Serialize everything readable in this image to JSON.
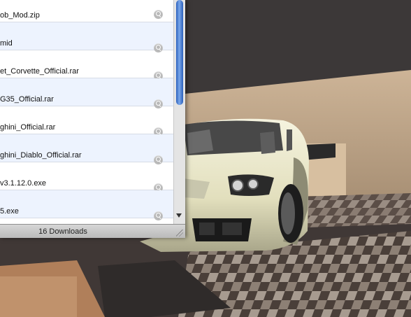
{
  "downloads": {
    "items": [
      {
        "name": "ob_Mod.zip",
        "icon": "magnifier-icon"
      },
      {
        "name": "mid",
        "icon": "magnifier-icon"
      },
      {
        "name": "et_Corvette_Official.rar",
        "icon": "magnifier-icon"
      },
      {
        "name": "G35_Official.rar",
        "icon": "magnifier-icon"
      },
      {
        "name": "ghini_Official.rar",
        "icon": "magnifier-icon"
      },
      {
        "name": "ghini_Diablo_Official.rar",
        "icon": "magnifier-icon"
      },
      {
        "name": "v3.1.12.0.exe",
        "icon": "magnifier-icon"
      },
      {
        "name": "5.exe",
        "icon": "magnifier-icon"
      }
    ],
    "count_label": "16 Downloads"
  },
  "colors": {
    "row_alt": "#edf3fe",
    "scroll_thumb": "#2a5fbc",
    "car_body": "#ecebd2"
  }
}
